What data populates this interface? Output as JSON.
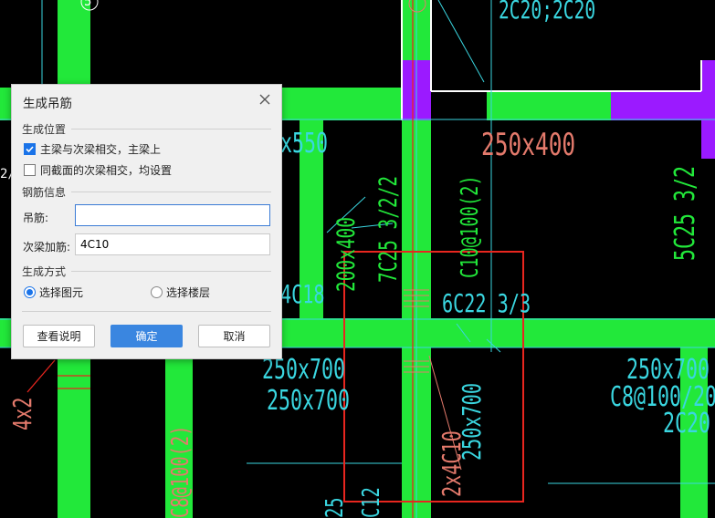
{
  "cad": {
    "labels": {
      "t1": "2C20;2C20",
      "t2": "250x400",
      "t3": "5C25 3/2",
      "t4": "C10@100(2)",
      "t5": "7C25 3/2/2",
      "t6": "200x400",
      "t7": "6C22 3/3",
      "t8": "250x700",
      "t9": "250x700",
      "t10": "250x700",
      "t11": "C8@100/20",
      "t12": "2C20",
      "t13": "2x4C10",
      "t14": "250x700",
      "t15": "4x2",
      "t16": "C8@100(2)",
      "t17": "4C18",
      "t18": "x550",
      "t19": "5",
      "t20": "C12",
      "t21": "25",
      "t22": "2/"
    }
  },
  "dialog": {
    "title": "生成吊筋",
    "sections": {
      "position": "生成位置",
      "rebar": "钢筋信息",
      "method": "生成方式"
    },
    "options": {
      "main_secondary": {
        "label": "主梁与次梁相交，主梁上",
        "checked": true
      },
      "same_section": {
        "label": "同截面的次梁相交，均设置",
        "checked": false
      }
    },
    "fields": {
      "hanger_label": "吊筋:",
      "hanger_value": "",
      "secondary_label": "次梁加筋:",
      "secondary_value": "4C10"
    },
    "method": {
      "select_element": {
        "label": "选择图元",
        "selected": true
      },
      "select_floor": {
        "label": "选择楼层",
        "selected": false
      }
    },
    "buttons": {
      "help": "查看说明",
      "ok": "确定",
      "cancel": "取消"
    }
  },
  "colors": {
    "beam": "#22e83a",
    "cyan": "#3ad6e0",
    "purple": "#9b1aff",
    "annotation": "#e47a6c",
    "highlight": "#e8261f",
    "accent": "#3a86e0"
  }
}
